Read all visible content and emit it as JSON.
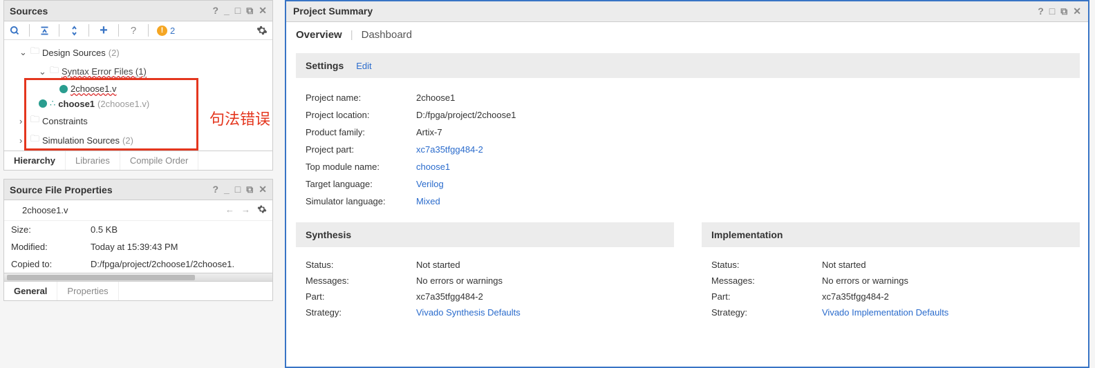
{
  "sources_panel": {
    "title": "Sources",
    "toolbar": {
      "warning_count": "2"
    },
    "tree": {
      "design_sources": {
        "label": "Design Sources",
        "count": "(2)"
      },
      "syntax_error": {
        "label": "Syntax Error Files (1)"
      },
      "file1": {
        "label": "2choose1.v"
      },
      "choose1": {
        "label": "choose1",
        "file": "(2choose1.v)"
      },
      "constraints": {
        "label": "Constraints"
      },
      "sim_sources": {
        "label": "Simulation Sources",
        "count": "(2)"
      }
    },
    "tabs": {
      "hierarchy": "Hierarchy",
      "libraries": "Libraries",
      "compile_order": "Compile Order"
    }
  },
  "annotation_text": "句法错误",
  "props_panel": {
    "title": "Source File Properties",
    "filename": "2choose1.v",
    "rows": {
      "size": {
        "label": "Size:",
        "value": "0.5 KB"
      },
      "modified": {
        "label": "Modified:",
        "value": "Today at 15:39:43 PM"
      },
      "copied": {
        "label": "Copied to:",
        "value": "D:/fpga/project/2choose1/2choose1."
      }
    },
    "tabs": {
      "general": "General",
      "properties": "Properties"
    }
  },
  "summary": {
    "title": "Project Summary",
    "tabs": {
      "overview": "Overview",
      "dashboard": "Dashboard"
    },
    "settings": {
      "title": "Settings",
      "edit": "Edit"
    },
    "kv": {
      "project_name": {
        "k": "Project name:",
        "v": "2choose1"
      },
      "project_location": {
        "k": "Project location:",
        "v": "D:/fpga/project/2choose1"
      },
      "product_family": {
        "k": "Product family:",
        "v": "Artix-7"
      },
      "project_part": {
        "k": "Project part:",
        "v": "xc7a35tfgg484-2"
      },
      "top_module": {
        "k": "Top module name:",
        "v": "choose1"
      },
      "target_lang": {
        "k": "Target language:",
        "v": "Verilog"
      },
      "sim_lang": {
        "k": "Simulator language:",
        "v": "Mixed"
      }
    },
    "synthesis": {
      "title": "Synthesis",
      "status": {
        "k": "Status:",
        "v": "Not started"
      },
      "messages": {
        "k": "Messages:",
        "v": "No errors or warnings"
      },
      "part": {
        "k": "Part:",
        "v": "xc7a35tfgg484-2"
      },
      "strategy": {
        "k": "Strategy:",
        "v": "Vivado Synthesis Defaults"
      }
    },
    "implementation": {
      "title": "Implementation",
      "status": {
        "k": "Status:",
        "v": "Not started"
      },
      "messages": {
        "k": "Messages:",
        "v": "No errors or warnings"
      },
      "part": {
        "k": "Part:",
        "v": "xc7a35tfgg484-2"
      },
      "strategy": {
        "k": "Strategy:",
        "v": "Vivado Implementation Defaults"
      }
    }
  }
}
